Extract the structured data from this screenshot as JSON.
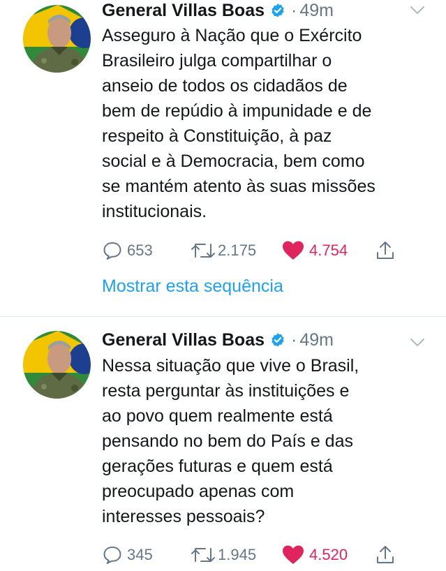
{
  "tweets": [
    {
      "author": "General Villas Boas",
      "separator": "·",
      "time": "49m",
      "text": "Asseguro à Nação que o Exército\nBrasileiro julga compartilhar o\nanseio de todos os cidadãos de\nbem de repúdio à impunidade e de\nrespeito à Constituição, à paz\nsocial e à Democracia, bem como\nse mantém atento às suas missões\ninstitucionais.",
      "replies": "653",
      "retweets": "2.175",
      "likes": "4.754",
      "thread_link": "Mostrar esta sequência",
      "liked": true
    },
    {
      "author": "General Villas Boas",
      "separator": "·",
      "time": "49m",
      "text": "Nessa situação que vive o Brasil,\nresta perguntar às instituições e\nao povo quem realmente está\npensando no bem do País e das\ngerações futuras e quem está\npreocupado apenas com\ninteresses pessoais?",
      "replies": "345",
      "retweets": "1.945",
      "likes": "4.520",
      "liked": true
    }
  ],
  "colors": {
    "verified": "#1da1f2",
    "like": "#e0245e",
    "link": "#1da1f2",
    "muted": "#657786"
  },
  "icons": [
    "verified-badge-icon",
    "chevron-down-icon",
    "reply-icon",
    "retweet-icon",
    "heart-icon",
    "share-icon"
  ]
}
